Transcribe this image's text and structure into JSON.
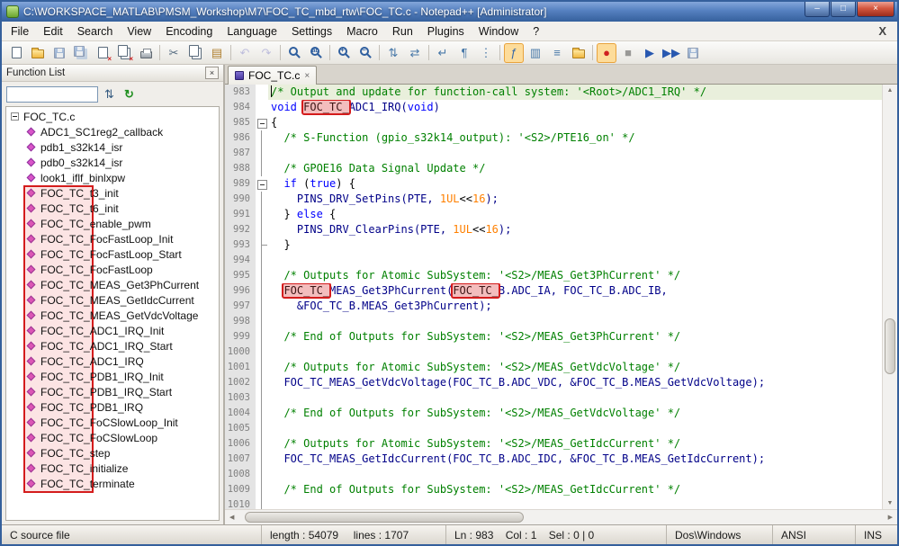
{
  "window": {
    "title": "C:\\WORKSPACE_MATLAB\\PMSM_Workshop\\M7\\FOC_TC_mbd_rtw\\FOC_TC.c - Notepad++ [Administrator]",
    "controls": {
      "minimize": "–",
      "maximize": "□",
      "close": "×"
    }
  },
  "menubar": {
    "items": [
      "File",
      "Edit",
      "Search",
      "View",
      "Encoding",
      "Language",
      "Settings",
      "Macro",
      "Run",
      "Plugins",
      "Window",
      "?"
    ],
    "close_label": "X"
  },
  "toolbar": {
    "icons": [
      {
        "name": "new-file",
        "kind": "page"
      },
      {
        "name": "open-file",
        "kind": "folder"
      },
      {
        "name": "save",
        "kind": "floppy",
        "dim": true
      },
      {
        "name": "save-all",
        "kind": "floppys",
        "dim": true
      },
      {
        "name": "close-file",
        "kind": "page",
        "x": true
      },
      {
        "name": "close-all-files",
        "kind": "pages",
        "x": true
      },
      {
        "name": "print",
        "kind": "printer"
      },
      {
        "sep": true
      },
      {
        "name": "cut",
        "kind": "glyph",
        "g": "✂",
        "c": "#556b80"
      },
      {
        "name": "copy",
        "kind": "pages"
      },
      {
        "name": "paste",
        "kind": "glyph",
        "g": "▤",
        "c": "#b08030"
      },
      {
        "sep": true
      },
      {
        "name": "undo",
        "kind": "glyph",
        "g": "↶",
        "c": "#8080c8",
        "dim": true
      },
      {
        "name": "redo",
        "kind": "glyph",
        "g": "↷",
        "c": "#8080c8",
        "dim": true
      },
      {
        "sep": true
      },
      {
        "name": "find",
        "kind": "zoom"
      },
      {
        "name": "replace",
        "kind": "zoom",
        "g": "ab"
      },
      {
        "sep": true
      },
      {
        "name": "zoom-in",
        "kind": "zoom",
        "g": "+"
      },
      {
        "name": "zoom-out",
        "kind": "zoom",
        "g": "−"
      },
      {
        "sep": true
      },
      {
        "name": "sync-scroll-vertical",
        "kind": "glyph",
        "g": "⇅",
        "c": "#4878a8"
      },
      {
        "name": "sync-scroll-horizontal",
        "kind": "glyph",
        "g": "⇄",
        "c": "#4878a8"
      },
      {
        "sep": true
      },
      {
        "name": "word-wrap",
        "kind": "glyph",
        "g": "↵",
        "c": "#4878a8"
      },
      {
        "name": "show-all-characters",
        "kind": "glyph",
        "g": "¶",
        "c": "#4878a8"
      },
      {
        "name": "indent-guide",
        "kind": "glyph",
        "g": "⋮",
        "c": "#4878a8"
      },
      {
        "sep": true
      },
      {
        "name": "function-list",
        "kind": "glyph",
        "g": "ƒ",
        "c": "#3868a8",
        "pressed": true
      },
      {
        "name": "document-map",
        "kind": "glyph",
        "g": "▥",
        "c": "#4878a8"
      },
      {
        "name": "document-list",
        "kind": "glyph",
        "g": "≡",
        "c": "#4878a8"
      },
      {
        "name": "folder-as-workspace",
        "kind": "folder"
      },
      {
        "sep": true
      },
      {
        "name": "record-macro",
        "kind": "glyph",
        "g": "●",
        "c": "#d02020",
        "pressed": true
      },
      {
        "name": "stop-recording",
        "kind": "glyph",
        "g": "■",
        "c": "#303030",
        "dim": true
      },
      {
        "name": "playback-macro",
        "kind": "glyph",
        "g": "▶",
        "c": "#2858b0"
      },
      {
        "name": "run-macro-multiple-times",
        "kind": "glyph",
        "g": "▶▶",
        "c": "#2858b0"
      },
      {
        "name": "save-recorded-macro",
        "kind": "floppy",
        "dim": true
      }
    ]
  },
  "panel": {
    "title": "Function List",
    "close_glyph": "×",
    "search_value": "",
    "sort_icon": "⇅",
    "refresh_icon": "↻",
    "root": "FOC_TC.c",
    "highlight_color": "#d41c1c",
    "items": [
      {
        "prefix": "",
        "name": "ADC1_SC1reg2_callback"
      },
      {
        "prefix": "",
        "name": "pdb1_s32k14_isr"
      },
      {
        "prefix": "",
        "name": "pdb0_s32k14_isr"
      },
      {
        "prefix": "",
        "name": "look1_iflf_binlxpw"
      },
      {
        "prefix": "FOC_TC_",
        "name": "t3_init"
      },
      {
        "prefix": "FOC_TC_",
        "name": "t6_init"
      },
      {
        "prefix": "FOC_TC_",
        "name": "enable_pwm"
      },
      {
        "prefix": "FOC_TC_",
        "name": "FocFastLoop_Init"
      },
      {
        "prefix": "FOC_TC_",
        "name": "FocFastLoop_Start"
      },
      {
        "prefix": "FOC_TC_",
        "name": "FocFastLoop"
      },
      {
        "prefix": "FOC_TC_",
        "name": "MEAS_Get3PhCurrent"
      },
      {
        "prefix": "FOC_TC_",
        "name": "MEAS_GetIdcCurrent"
      },
      {
        "prefix": "FOC_TC_",
        "name": "MEAS_GetVdcVoltage"
      },
      {
        "prefix": "FOC_TC_",
        "name": "ADC1_IRQ_Init"
      },
      {
        "prefix": "FOC_TC_",
        "name": "ADC1_IRQ_Start"
      },
      {
        "prefix": "FOC_TC_",
        "name": "ADC1_IRQ"
      },
      {
        "prefix": "FOC_TC_",
        "name": "PDB1_IRQ_Init"
      },
      {
        "prefix": "FOC_TC_",
        "name": "PDB1_IRQ_Start"
      },
      {
        "prefix": "FOC_TC_",
        "name": "PDB1_IRQ"
      },
      {
        "prefix": "FOC_TC_",
        "name": "FoCSlowLoop_Init"
      },
      {
        "prefix": "FOC_TC_",
        "name": "FoCSlowLoop"
      },
      {
        "prefix": "FOC_TC_",
        "name": "step"
      },
      {
        "prefix": "FOC_TC_",
        "name": "initialize"
      },
      {
        "prefix": "FOC_TC_",
        "name": "terminate"
      }
    ]
  },
  "editor": {
    "tab": {
      "label": "FOC_TC.c",
      "close_glyph": "×"
    },
    "highlight_color": "#d41c1c",
    "colors": {
      "c": "#008000",
      "k": "#0000ff",
      "p": "#000000",
      "i": "#000088",
      "n": "#ff8000"
    },
    "lines": [
      {
        "n": 983,
        "cur": true,
        "fold": "",
        "seg": [
          [
            "c",
            "/* Output and update for function-call system: '<Root>/ADC1_IRQ' */"
          ]
        ]
      },
      {
        "n": 984,
        "fold": "",
        "seg": [
          [
            "k",
            "void "
          ],
          [
            "h",
            "FOC_TC_"
          ],
          [
            "i",
            "ADC1_IRQ("
          ],
          [
            "k",
            "void"
          ],
          [
            "i",
            ")"
          ]
        ]
      },
      {
        "n": 985,
        "fold": "box",
        "seg": [
          [
            "p",
            "{"
          ]
        ]
      },
      {
        "n": 986,
        "fold": "line",
        "seg": [
          [
            "c",
            "  /* S-Function (gpio_s32k14_output): '<S2>/PTE16_on' */"
          ]
        ]
      },
      {
        "n": 987,
        "fold": "line",
        "seg": []
      },
      {
        "n": 988,
        "fold": "line",
        "seg": [
          [
            "c",
            "  /* GPOE16 Data Signal Update */"
          ]
        ]
      },
      {
        "n": 989,
        "fold": "box",
        "seg": [
          [
            "p",
            "  "
          ],
          [
            "k",
            "if"
          ],
          [
            "p",
            " ("
          ],
          [
            "k",
            "true"
          ],
          [
            "p",
            ") {"
          ]
        ]
      },
      {
        "n": 990,
        "fold": "line",
        "seg": [
          [
            "i",
            "    PINS_DRV_SetPins(PTE, "
          ],
          [
            "n",
            "1UL"
          ],
          [
            "p",
            "<<"
          ],
          [
            "n",
            "16"
          ],
          [
            "i",
            ");"
          ]
        ]
      },
      {
        "n": 991,
        "fold": "line",
        "seg": [
          [
            "p",
            "  } "
          ],
          [
            "k",
            "else"
          ],
          [
            "p",
            " {"
          ]
        ]
      },
      {
        "n": 992,
        "fold": "line",
        "seg": [
          [
            "i",
            "    PINS_DRV_ClearPins(PTE, "
          ],
          [
            "n",
            "1UL"
          ],
          [
            "p",
            "<<"
          ],
          [
            "n",
            "16"
          ],
          [
            "i",
            ");"
          ]
        ]
      },
      {
        "n": 993,
        "fold": "end",
        "seg": [
          [
            "p",
            "  }"
          ]
        ]
      },
      {
        "n": 994,
        "fold": "line",
        "seg": []
      },
      {
        "n": 995,
        "fold": "line",
        "seg": [
          [
            "c",
            "  /* Outputs for Atomic SubSystem: '<S2>/MEAS_Get3PhCurrent' */"
          ]
        ]
      },
      {
        "n": 996,
        "fold": "line",
        "seg": [
          [
            "p",
            "  "
          ],
          [
            "h",
            "FOC_TC_"
          ],
          [
            "i",
            "MEAS_Get3PhCurrent("
          ],
          [
            "h",
            "FOC_TC_"
          ],
          [
            "i",
            "B.ADC_IA, FOC_TC_B.ADC_IB,"
          ]
        ]
      },
      {
        "n": 997,
        "fold": "line",
        "seg": [
          [
            "i",
            "    &FOC_TC_B.MEAS_Get3PhCurrent);"
          ]
        ]
      },
      {
        "n": 998,
        "fold": "line",
        "seg": []
      },
      {
        "n": 999,
        "fold": "line",
        "seg": [
          [
            "c",
            "  /* End of Outputs for SubSystem: '<S2>/MEAS_Get3PhCurrent' */"
          ]
        ]
      },
      {
        "n": 1000,
        "fold": "line",
        "seg": []
      },
      {
        "n": 1001,
        "fold": "line",
        "seg": [
          [
            "c",
            "  /* Outputs for Atomic SubSystem: '<S2>/MEAS_GetVdcVoltage' */"
          ]
        ]
      },
      {
        "n": 1002,
        "fold": "line",
        "seg": [
          [
            "i",
            "  FOC_TC_MEAS_GetVdcVoltage(FOC_TC_B.ADC_VDC, &FOC_TC_B.MEAS_GetVdcVoltage);"
          ]
        ]
      },
      {
        "n": 1003,
        "fold": "line",
        "seg": []
      },
      {
        "n": 1004,
        "fold": "line",
        "seg": [
          [
            "c",
            "  /* End of Outputs for SubSystem: '<S2>/MEAS_GetVdcVoltage' */"
          ]
        ]
      },
      {
        "n": 1005,
        "fold": "line",
        "seg": []
      },
      {
        "n": 1006,
        "fold": "line",
        "seg": [
          [
            "c",
            "  /* Outputs for Atomic SubSystem: '<S2>/MEAS_GetIdcCurrent' */"
          ]
        ]
      },
      {
        "n": 1007,
        "fold": "line",
        "seg": [
          [
            "i",
            "  FOC_TC_MEAS_GetIdcCurrent(FOC_TC_B.ADC_IDC, &FOC_TC_B.MEAS_GetIdcCurrent);"
          ]
        ]
      },
      {
        "n": 1008,
        "fold": "line",
        "seg": []
      },
      {
        "n": 1009,
        "fold": "line",
        "seg": [
          [
            "c",
            "  /* End of Outputs for SubSystem: '<S2>/MEAS_GetIdcCurrent' */"
          ]
        ]
      },
      {
        "n": 1010,
        "fold": "line",
        "seg": []
      }
    ]
  },
  "statusbar": {
    "doctype": "C source file",
    "length_lines": "length : 54079     lines : 1707",
    "position": "Ln : 983    Col : 1    Sel : 0 | 0",
    "eol": "Dos\\Windows",
    "encoding": "ANSI",
    "insert_mode": "INS"
  }
}
